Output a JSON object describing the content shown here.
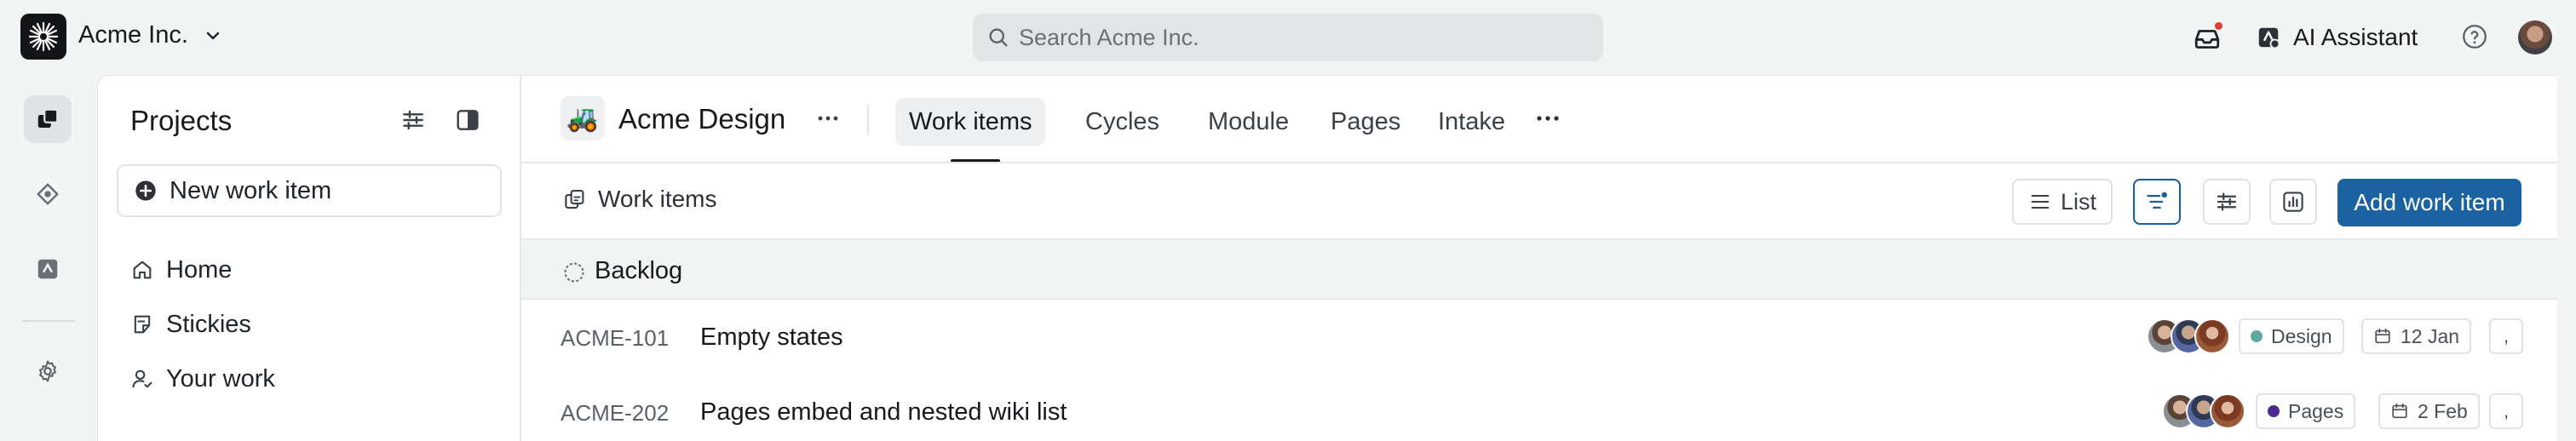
{
  "workspace": {
    "name": "Acme Inc."
  },
  "search": {
    "placeholder": "Search Acme Inc."
  },
  "topbar": {
    "ai_label": "AI Assistant"
  },
  "sidebar": {
    "title": "Projects",
    "new_item_label": "New work item",
    "items": [
      {
        "label": "Home",
        "icon": "home-icon"
      },
      {
        "label": "Stickies",
        "icon": "sticky-note-icon"
      },
      {
        "label": "Your work",
        "icon": "user-check-icon"
      }
    ]
  },
  "project": {
    "emoji": "🚜",
    "name": "Acme Design",
    "tabs": [
      {
        "label": "Work items",
        "active": true
      },
      {
        "label": "Cycles"
      },
      {
        "label": "Module"
      },
      {
        "label": "Pages"
      },
      {
        "label": "Intake"
      }
    ]
  },
  "toolbar": {
    "section_label": "Work items",
    "layout_label": "List",
    "add_label": "Add work item"
  },
  "group": {
    "name": "Backlog"
  },
  "issues": [
    {
      "id": "ACME-101",
      "title": "Empty states",
      "label": "Design",
      "label_color": "#5fa8a0",
      "date": "12 Jan",
      "more": ","
    },
    {
      "id": "ACME-202",
      "title": "Pages embed and nested wiki list",
      "label": "Pages",
      "label_color": "#4b2b8f",
      "date": "2 Feb",
      "more": ","
    }
  ],
  "colors": {
    "accent": "#1a62a0",
    "notification": "#e53935"
  }
}
